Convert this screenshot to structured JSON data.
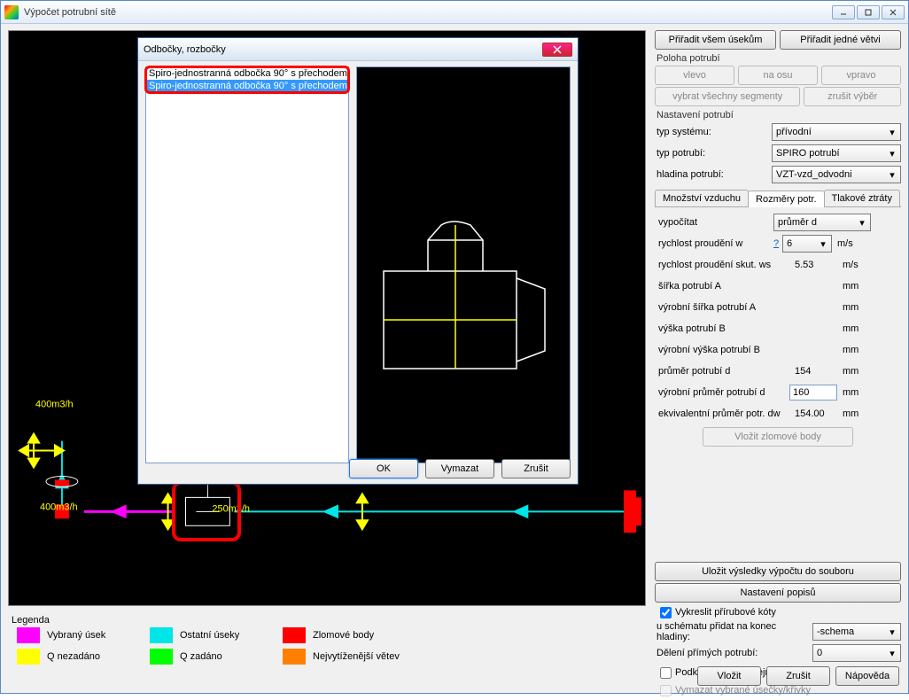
{
  "window": {
    "title": "Výpočet potrubní sítě"
  },
  "dialog": {
    "title": "Odbočky, rozbočky",
    "items": {
      "item0": "Spiro-jednostranná odbočka 90° s přechodem",
      "item1": "Spiro-jednostranná odbočka 90° s přechodem"
    },
    "buttons": {
      "ok": "OK",
      "clear": "Vymazat",
      "cancel": "Zrušit"
    }
  },
  "right": {
    "assign_all": "Přiřadit všem úsekům",
    "assign_one": "Přiřadit jedné větvi",
    "position_group": "Poloha potrubí",
    "pos_left": "vlevo",
    "pos_axis": "na osu",
    "pos_right": "vpravo",
    "select_all_seg": "vybrat všechny segmenty",
    "cancel_sel": "zrušit výběr",
    "settings_group": "Nastavení potrubí",
    "type_system_label": "typ systému:",
    "type_system_value": "přívodní",
    "type_pipe_label": "typ potrubí:",
    "type_pipe_value": "SPIRO potrubí",
    "level_label": "hladina potrubí:",
    "level_value": "VZT-vzd_odvodni",
    "tabs": {
      "t1": "Množství vzduchu",
      "t2": "Rozměry potr.",
      "t3": "Tlakové ztráty"
    },
    "calc_label": "vypočítat",
    "calc_value": "průměr d",
    "r1_label": "rychlost proudění w",
    "r1_q": "?",
    "r1_val": "6",
    "r1_unit": "m/s",
    "r2_label": "rychlost proudění skut. ws",
    "r2_val": "5.53",
    "r2_unit": "m/s",
    "r3_label": "šířka potrubí A",
    "r3_unit": "mm",
    "r4_label": "výrobní šířka potrubí A",
    "r4_unit": "mm",
    "r5_label": "výška potrubí B",
    "r5_unit": "mm",
    "r6_label": "výrobní výška potrubí B",
    "r6_unit": "mm",
    "r7_label": "průměr potrubí d",
    "r7_val": "154",
    "r7_unit": "mm",
    "r8_label": "výrobní průměr potrubí d",
    "r8_val": "160",
    "r8_unit": "mm",
    "r9_label": "ekvivalentní průměr potr. dw",
    "r9_val": "154.00",
    "r9_unit": "mm",
    "insert_break": "Vložit zlomové body",
    "save_results": "Uložit výsledky výpočtu do souboru",
    "caption_settings": "Nastavení popisů",
    "chk_flange": "Vykreslit přírubové kóty",
    "append_label": "u schématu přidat na konec hladiny:",
    "append_val": "-schema",
    "straight_div_label": "Dělení přímých potrubí:",
    "straight_div_val": "0",
    "chk_bg_same": "Podklad zobrazit stejnou barvou",
    "chk_del_sel": "Vymazat vybrané úsečky/křivky"
  },
  "footer": {
    "insert": "Vložit",
    "cancel": "Zrušit",
    "help": "Nápověda"
  },
  "legend": {
    "title": "Legenda",
    "i1": "Vybraný úsek",
    "i2": "Ostatní úseky",
    "i3": "Zlomové body",
    "i4": "Q nezadáno",
    "i5": "Q zadáno",
    "i6": "Nejvytíženější větev"
  },
  "canvas": {
    "flow_label": "400m3/h",
    "node_label": "250m3/h"
  }
}
